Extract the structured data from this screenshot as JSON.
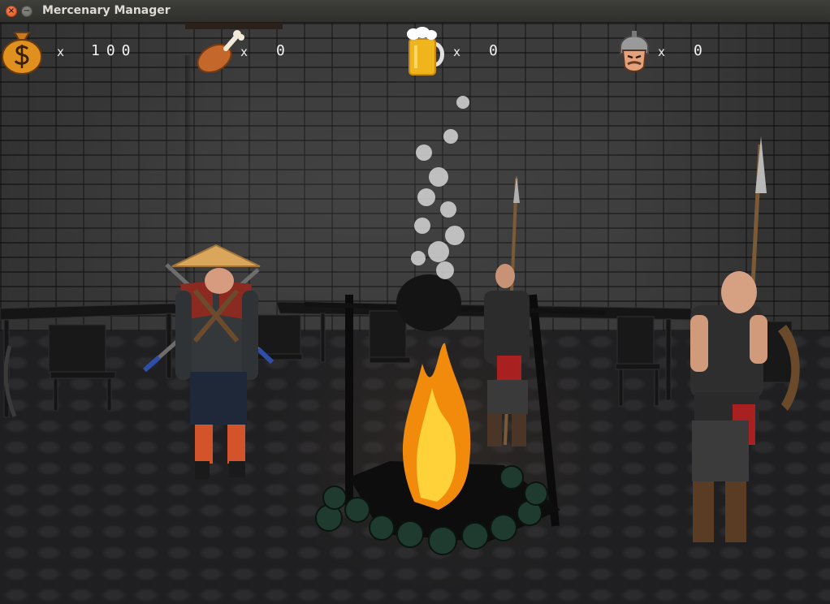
{
  "window": {
    "title": "Mercenary Manager",
    "close_glyph": "×",
    "minimize_glyph": "−"
  },
  "hud": [
    {
      "name": "money",
      "icon": "money-bag-icon",
      "multiplier": "x",
      "value": "100"
    },
    {
      "name": "food",
      "icon": "chicken-leg-icon",
      "multiplier": "x",
      "value": "0"
    },
    {
      "name": "beer",
      "icon": "beer-mug-icon",
      "multiplier": "x",
      "value": "0"
    },
    {
      "name": "mercenaries",
      "icon": "warrior-head-icon",
      "multiplier": "x",
      "value": "0"
    }
  ],
  "scene": {
    "location": "tavern",
    "characters": [
      "ronin-mercenary",
      "spearman-mercenary",
      "bald-spearman-mercenary"
    ],
    "colors": {
      "title_bar": "#3e3e3b",
      "close_button": "#e2531d",
      "wall": "#3b3b3b",
      "fire": "#f5a623"
    }
  }
}
